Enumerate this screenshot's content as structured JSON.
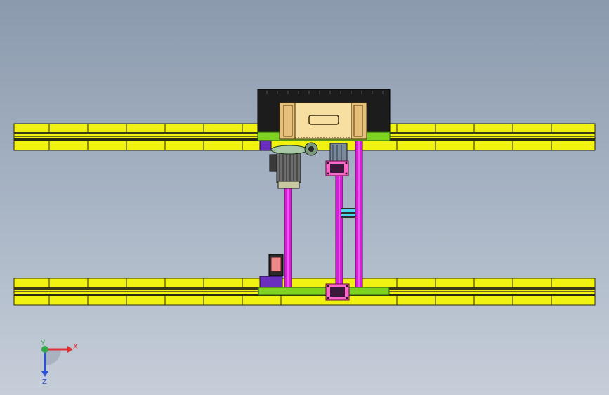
{
  "viewport": {
    "background_top": "#8c9aae",
    "background_bottom": "#c6ced9"
  },
  "colors": {
    "rail": "#f2f212",
    "rail_stroke": "#2a2a10",
    "carriage_top": "#1c1c1c",
    "carriage_green": "#7ed321",
    "housing": "#f7dfa2",
    "beam_magenta": "#d61ed6",
    "motor_gray": "#8a8a8a",
    "bearing_purple": "#6a2fbf",
    "bracket_pink": "#ff66cc",
    "spacer_cyan": "#4fd4f0"
  },
  "triad": {
    "x_label": "X",
    "y_label": "Y",
    "z_label": "Z",
    "x_color": "#e03030",
    "y_color": "#2ea84a",
    "z_color": "#2e50d8"
  }
}
